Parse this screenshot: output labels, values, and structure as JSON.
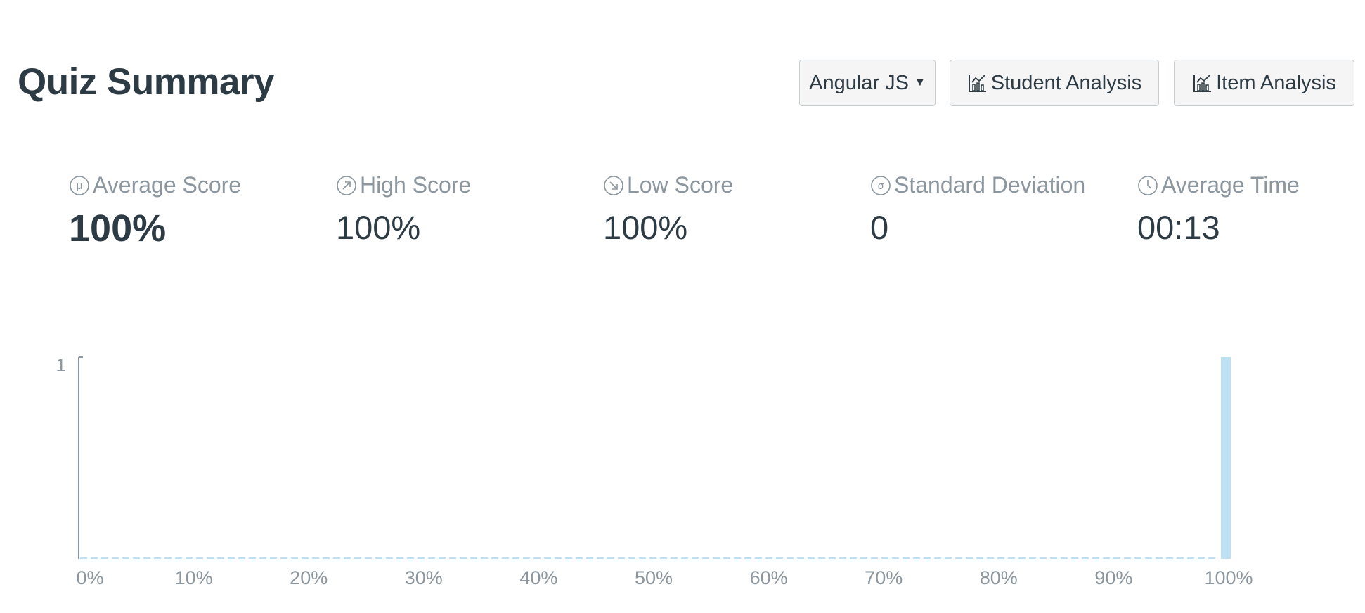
{
  "header": {
    "title": "Quiz Summary",
    "section_dropdown_label": "Angular JS",
    "student_analysis_label": "Student Analysis",
    "item_analysis_label": "Item Analysis"
  },
  "stats": {
    "average_score": {
      "label": "Average Score",
      "value": "100%",
      "icon": "mu-icon"
    },
    "high_score": {
      "label": "High Score",
      "value": "100%",
      "icon": "arrow-up-right-icon"
    },
    "low_score": {
      "label": "Low Score",
      "value": "100%",
      "icon": "arrow-down-right-icon"
    },
    "std_dev": {
      "label": "Standard Deviation",
      "value": "0",
      "icon": "sigma-icon"
    },
    "average_time": {
      "label": "Average Time",
      "value": "00:13",
      "icon": "clock-icon"
    }
  },
  "chart_data": {
    "type": "bar",
    "categories": [
      "0%",
      "10%",
      "20%",
      "30%",
      "40%",
      "50%",
      "60%",
      "70%",
      "80%",
      "90%",
      "100%"
    ],
    "values": [
      0,
      0,
      0,
      0,
      0,
      0,
      0,
      0,
      0,
      0,
      1
    ],
    "xlabel": "",
    "ylabel": "",
    "ylim": [
      0,
      1
    ],
    "yticks": [
      "1"
    ],
    "bar_color": "#bee0f3"
  },
  "colors": {
    "text": "#2d3b45",
    "muted": "#8b969e",
    "bar": "#bee0f3",
    "button_bg": "#f5f5f5",
    "button_border": "#c7cdd1"
  }
}
